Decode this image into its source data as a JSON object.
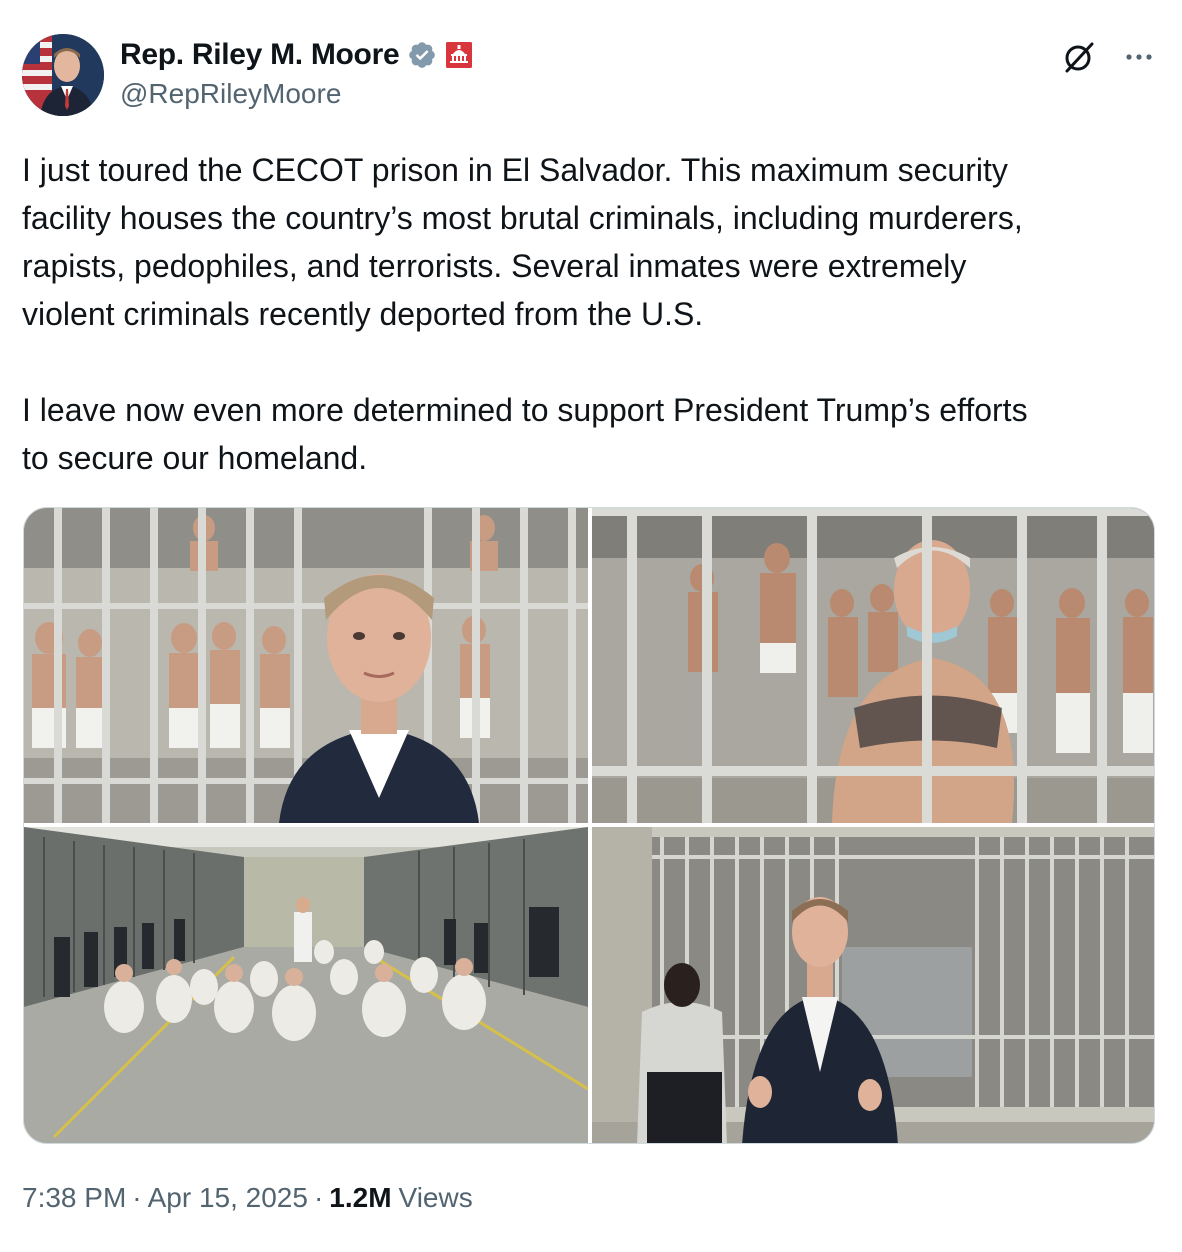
{
  "author": {
    "display_name": "Rep. Riley M. Moore",
    "handle": "@RepRileyMoore",
    "verified_icon": "verified-badge-icon",
    "affiliation_icon": "us-capitol-badge-icon"
  },
  "tweet": {
    "text": "I just toured the CECOT prison in El Salvador. This maximum security\nfacility houses the country’s most brutal criminals, including murderers,\nrapists, pedophiles, and terrorists. Several inmates were extremely\nviolent criminals recently deported from the U.S.\n\nI leave now even more determined to support President Trump’s efforts\nto secure our homeland."
  },
  "media": {
    "count": 4,
    "items": [
      "photo-1",
      "photo-2",
      "photo-3",
      "photo-4"
    ]
  },
  "meta": {
    "time": "7:38 PM",
    "separator": "·",
    "date": "Apr 15, 2025",
    "views_count": "1.2M",
    "views_label": "Views"
  },
  "colors": {
    "text_primary": "#0f1419",
    "text_secondary": "#536471",
    "verified_blue": "#829aab",
    "border": "#cfd9de"
  }
}
